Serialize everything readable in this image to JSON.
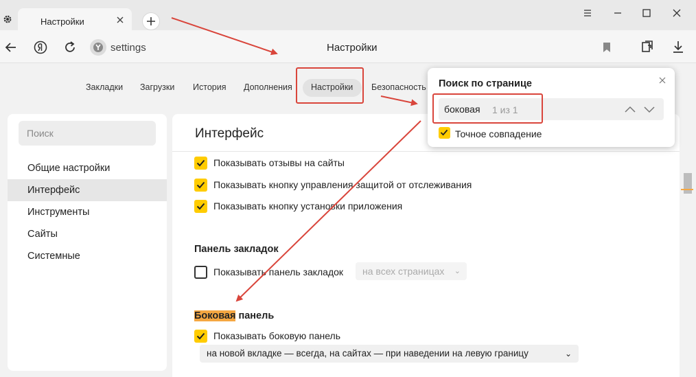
{
  "tab": {
    "title": "Настройки"
  },
  "address": {
    "url": "settings",
    "page_title": "Настройки"
  },
  "top_nav": [
    {
      "label": "Закладки"
    },
    {
      "label": "Загрузки"
    },
    {
      "label": "История"
    },
    {
      "label": "Дополнения"
    },
    {
      "label": "Настройки",
      "active": true
    },
    {
      "label": "Безопасность"
    }
  ],
  "sidebar": {
    "search_placeholder": "Поиск",
    "items": [
      {
        "label": "Общие настройки"
      },
      {
        "label": "Интерфейс",
        "active": true
      },
      {
        "label": "Инструменты"
      },
      {
        "label": "Сайты"
      },
      {
        "label": "Системные"
      }
    ]
  },
  "main": {
    "title": "Интерфейс",
    "checkboxes": [
      {
        "label": "Показывать отзывы на сайты",
        "checked": true
      },
      {
        "label": "Показывать кнопку управления защитой от отслеживания",
        "checked": true
      },
      {
        "label": "Показывать кнопку установки приложения",
        "checked": true
      }
    ],
    "bookmarks_section": {
      "title": "Панель закладок",
      "checkbox_label": "Показывать панель закладок",
      "checked": false,
      "select_value": "на всех страницах"
    },
    "sidebar_section": {
      "title_highlight": "Боковая",
      "title_rest": " панель",
      "checkbox_label": "Показывать боковую панель",
      "checked": true,
      "select_value": "на новой вкладке — всегда, на сайтах — при наведении на левую границу"
    }
  },
  "find": {
    "title": "Поиск по странице",
    "query": "боковая",
    "count": "1 из 1",
    "exact_label": "Точное совпадение",
    "exact_checked": true
  },
  "colors": {
    "accent": "#ffcc00",
    "highlight": "#f5a742",
    "annotation": "#d9453b"
  }
}
